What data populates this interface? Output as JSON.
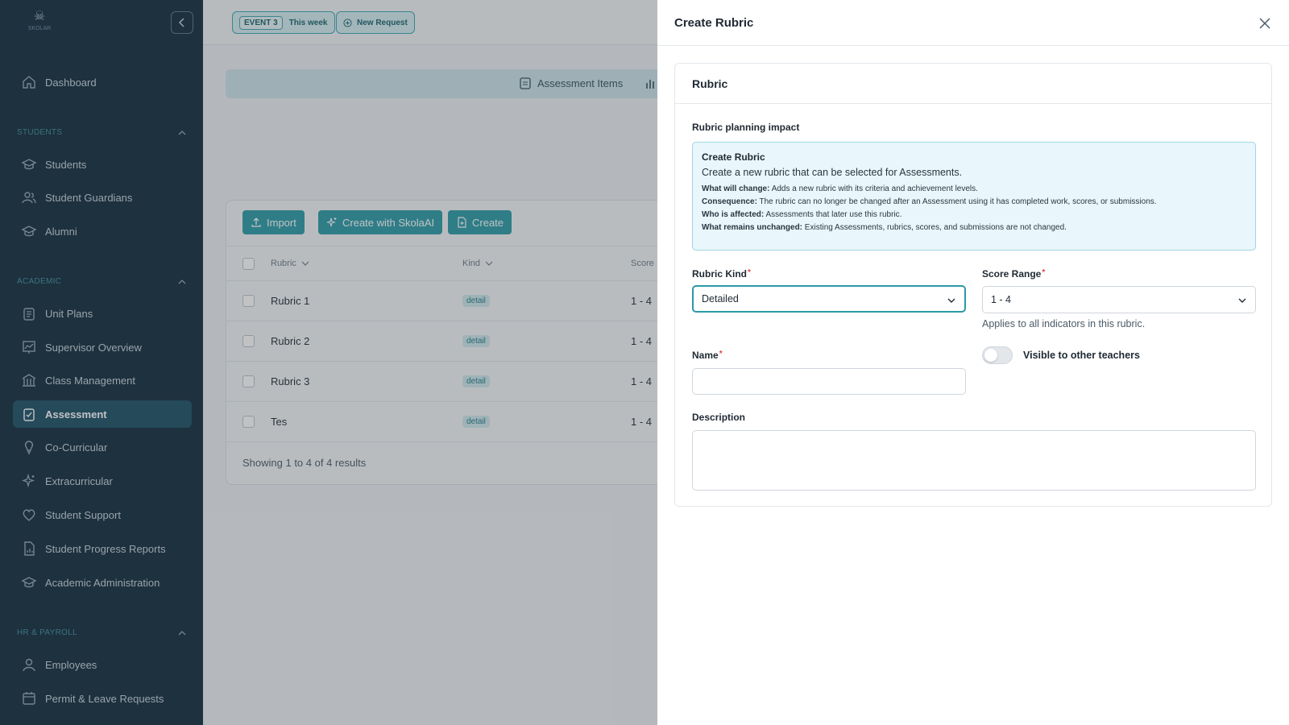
{
  "sidebar": {
    "logo_text": "SKOLAR",
    "items": {
      "dashboard": "Dashboard",
      "students": "Students",
      "student_guardians": "Student Guardians",
      "alumni": "Alumni",
      "unit_plans": "Unit Plans",
      "supervisor_overview": "Supervisor Overview",
      "class_management": "Class Management",
      "assessment": "Assessment",
      "co_curricular": "Co-Curricular",
      "extracurricular": "Extracurricular",
      "student_support": "Student Support",
      "student_progress_reports": "Student Progress Reports",
      "academic_administration": "Academic Administration",
      "employees": "Employees",
      "permit_leave": "Permit & Leave Requests"
    },
    "sections": {
      "students": "STUDENTS",
      "academic": "ACADEMIC",
      "hr": "HR & PAYROLL"
    },
    "active_item": "Assessment"
  },
  "topbar": {
    "event_tag": "EVENT 3",
    "event_label": "This week",
    "new_request": "New Request"
  },
  "tabs": {
    "assessment_items": "Assessment Items"
  },
  "toolbar": {
    "import": "Import",
    "create_ai": "Create with SkolaAI",
    "create": "Create"
  },
  "table": {
    "columns": [
      "Rubric",
      "Kind",
      "Score"
    ],
    "rows": [
      {
        "rubric": "Rubric 1",
        "kind": "detail",
        "score": "1 - 4"
      },
      {
        "rubric": "Rubric 2",
        "kind": "detail",
        "score": "1 - 4"
      },
      {
        "rubric": "Rubric 3",
        "kind": "detail",
        "score": "1 - 4"
      },
      {
        "rubric": "Tes",
        "kind": "detail",
        "score": "1 - 4"
      }
    ],
    "footer": "Showing 1 to 4 of 4 results"
  },
  "drawer": {
    "title": "Create Rubric",
    "card_title": "Rubric",
    "impact_label": "Rubric planning impact",
    "impact": {
      "title": "Create Rubric",
      "description": "Create a new rubric that can be selected for Assessments.",
      "lines": [
        {
          "key": "What will change:",
          "value": "Adds a new rubric with its criteria and achievement levels."
        },
        {
          "key": "Consequence:",
          "value": "The rubric can no longer be changed after an Assessment using it has completed work, scores, or submissions."
        },
        {
          "key": "Who is affected:",
          "value": "Assessments that later use this rubric."
        },
        {
          "key": "What remains unchanged:",
          "value": "Existing Assessments, rubrics, scores, and submissions are not changed."
        }
      ]
    },
    "rubric_kind": {
      "label": "Rubric Kind",
      "value": "Detailed",
      "required": "*"
    },
    "score_range": {
      "label": "Score Range",
      "value": "1 - 4",
      "required": "*",
      "hint": "Applies to all indicators in this rubric."
    },
    "name": {
      "label": "Name",
      "required": "*",
      "value": ""
    },
    "visibility": {
      "label": "Visible to other teachers",
      "enabled": false
    },
    "description": {
      "label": "Description",
      "value": ""
    }
  },
  "colors": {
    "sidebar_bg": "#0f2a3a",
    "accent": "#2a9aa6",
    "required": "#d64545"
  }
}
